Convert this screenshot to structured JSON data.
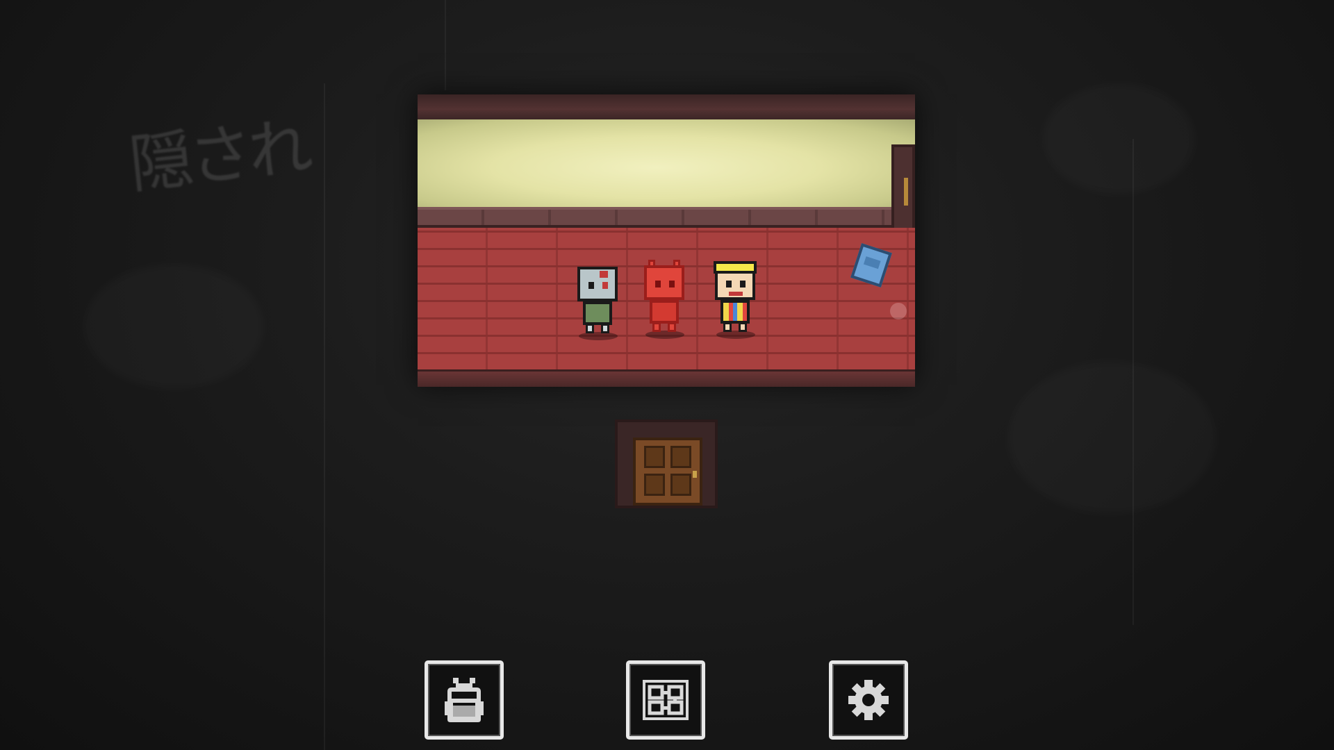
{
  "scene": {
    "wall_writing": "隠され",
    "room": {
      "characters": [
        {
          "name": "zombie-character"
        },
        {
          "name": "red-demon-character"
        },
        {
          "name": "clown-character"
        }
      ],
      "items": [
        {
          "name": "notebook-item"
        }
      ]
    },
    "exit": {
      "name": "door"
    }
  },
  "toolbar": {
    "buttons": [
      {
        "id": "bag",
        "icon": "backpack-icon"
      },
      {
        "id": "map",
        "icon": "map-icon"
      },
      {
        "id": "settings",
        "icon": "gear-icon"
      }
    ]
  },
  "colors": {
    "background": "#1a1a1a",
    "wall": "#e4e3a6",
    "floor": "#a8403f",
    "button_border": "#e8e8e8"
  }
}
